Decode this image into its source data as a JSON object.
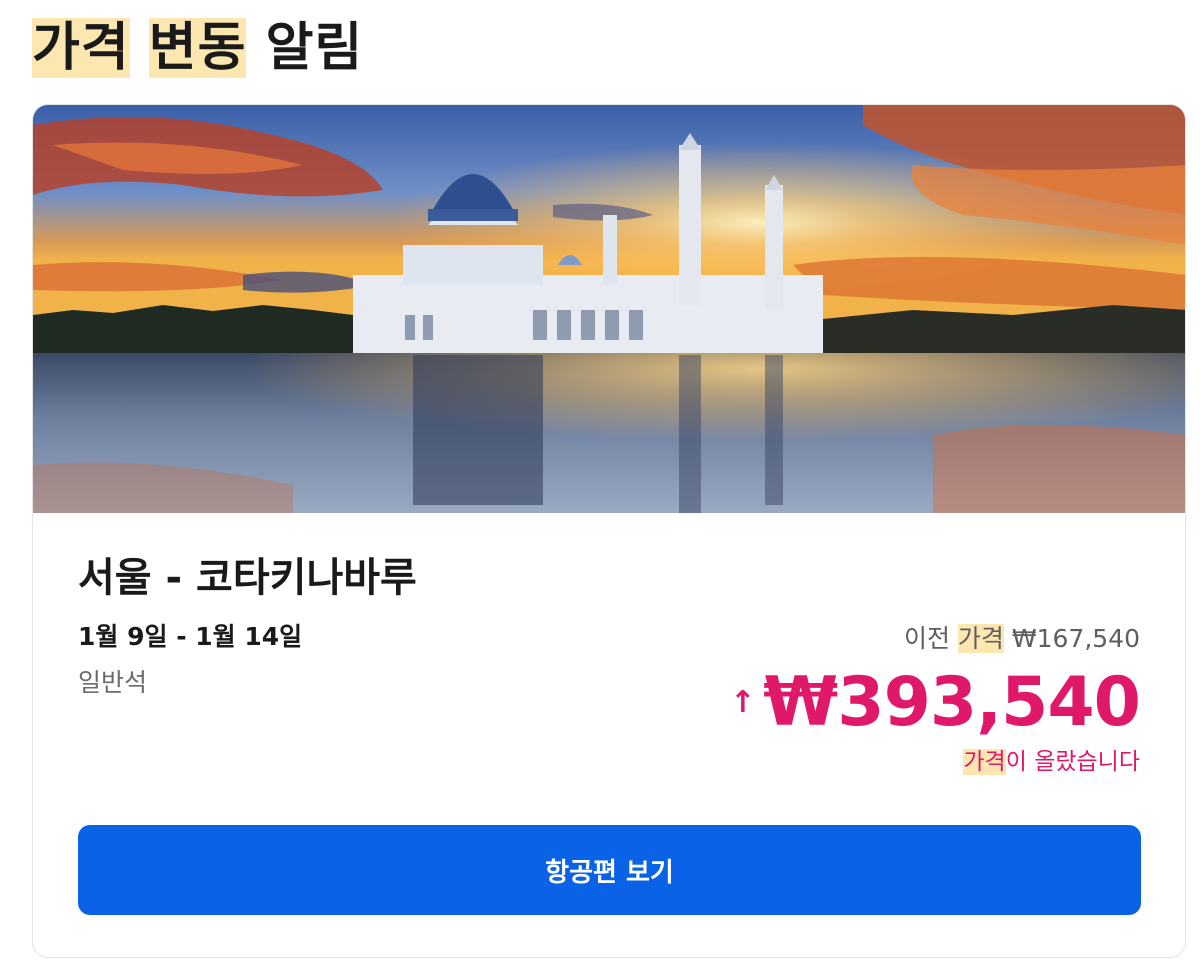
{
  "alert": {
    "title_parts": [
      "가격",
      "변동",
      "알림"
    ],
    "highlight_color": "#fde7b0"
  },
  "card": {
    "image": "kota-kinabalu-city-mosque-sunset-photo",
    "route": "서울 - 코타키나바루",
    "dates": "1월 9일 - 1월 14일",
    "cabin_class": "일반석",
    "previous_price_label_prefix": "이전",
    "previous_price_label_keyword": "가격",
    "previous_price": "₩167,540",
    "direction_icon": "arrow-up-icon",
    "current_price": "₩393,540",
    "change_note_keyword": "가격",
    "change_note_rest": "이 올랐습니다",
    "price_up_color": "#e0186a",
    "cta_label": "항공편 보기",
    "cta_color": "#0a63e6"
  }
}
